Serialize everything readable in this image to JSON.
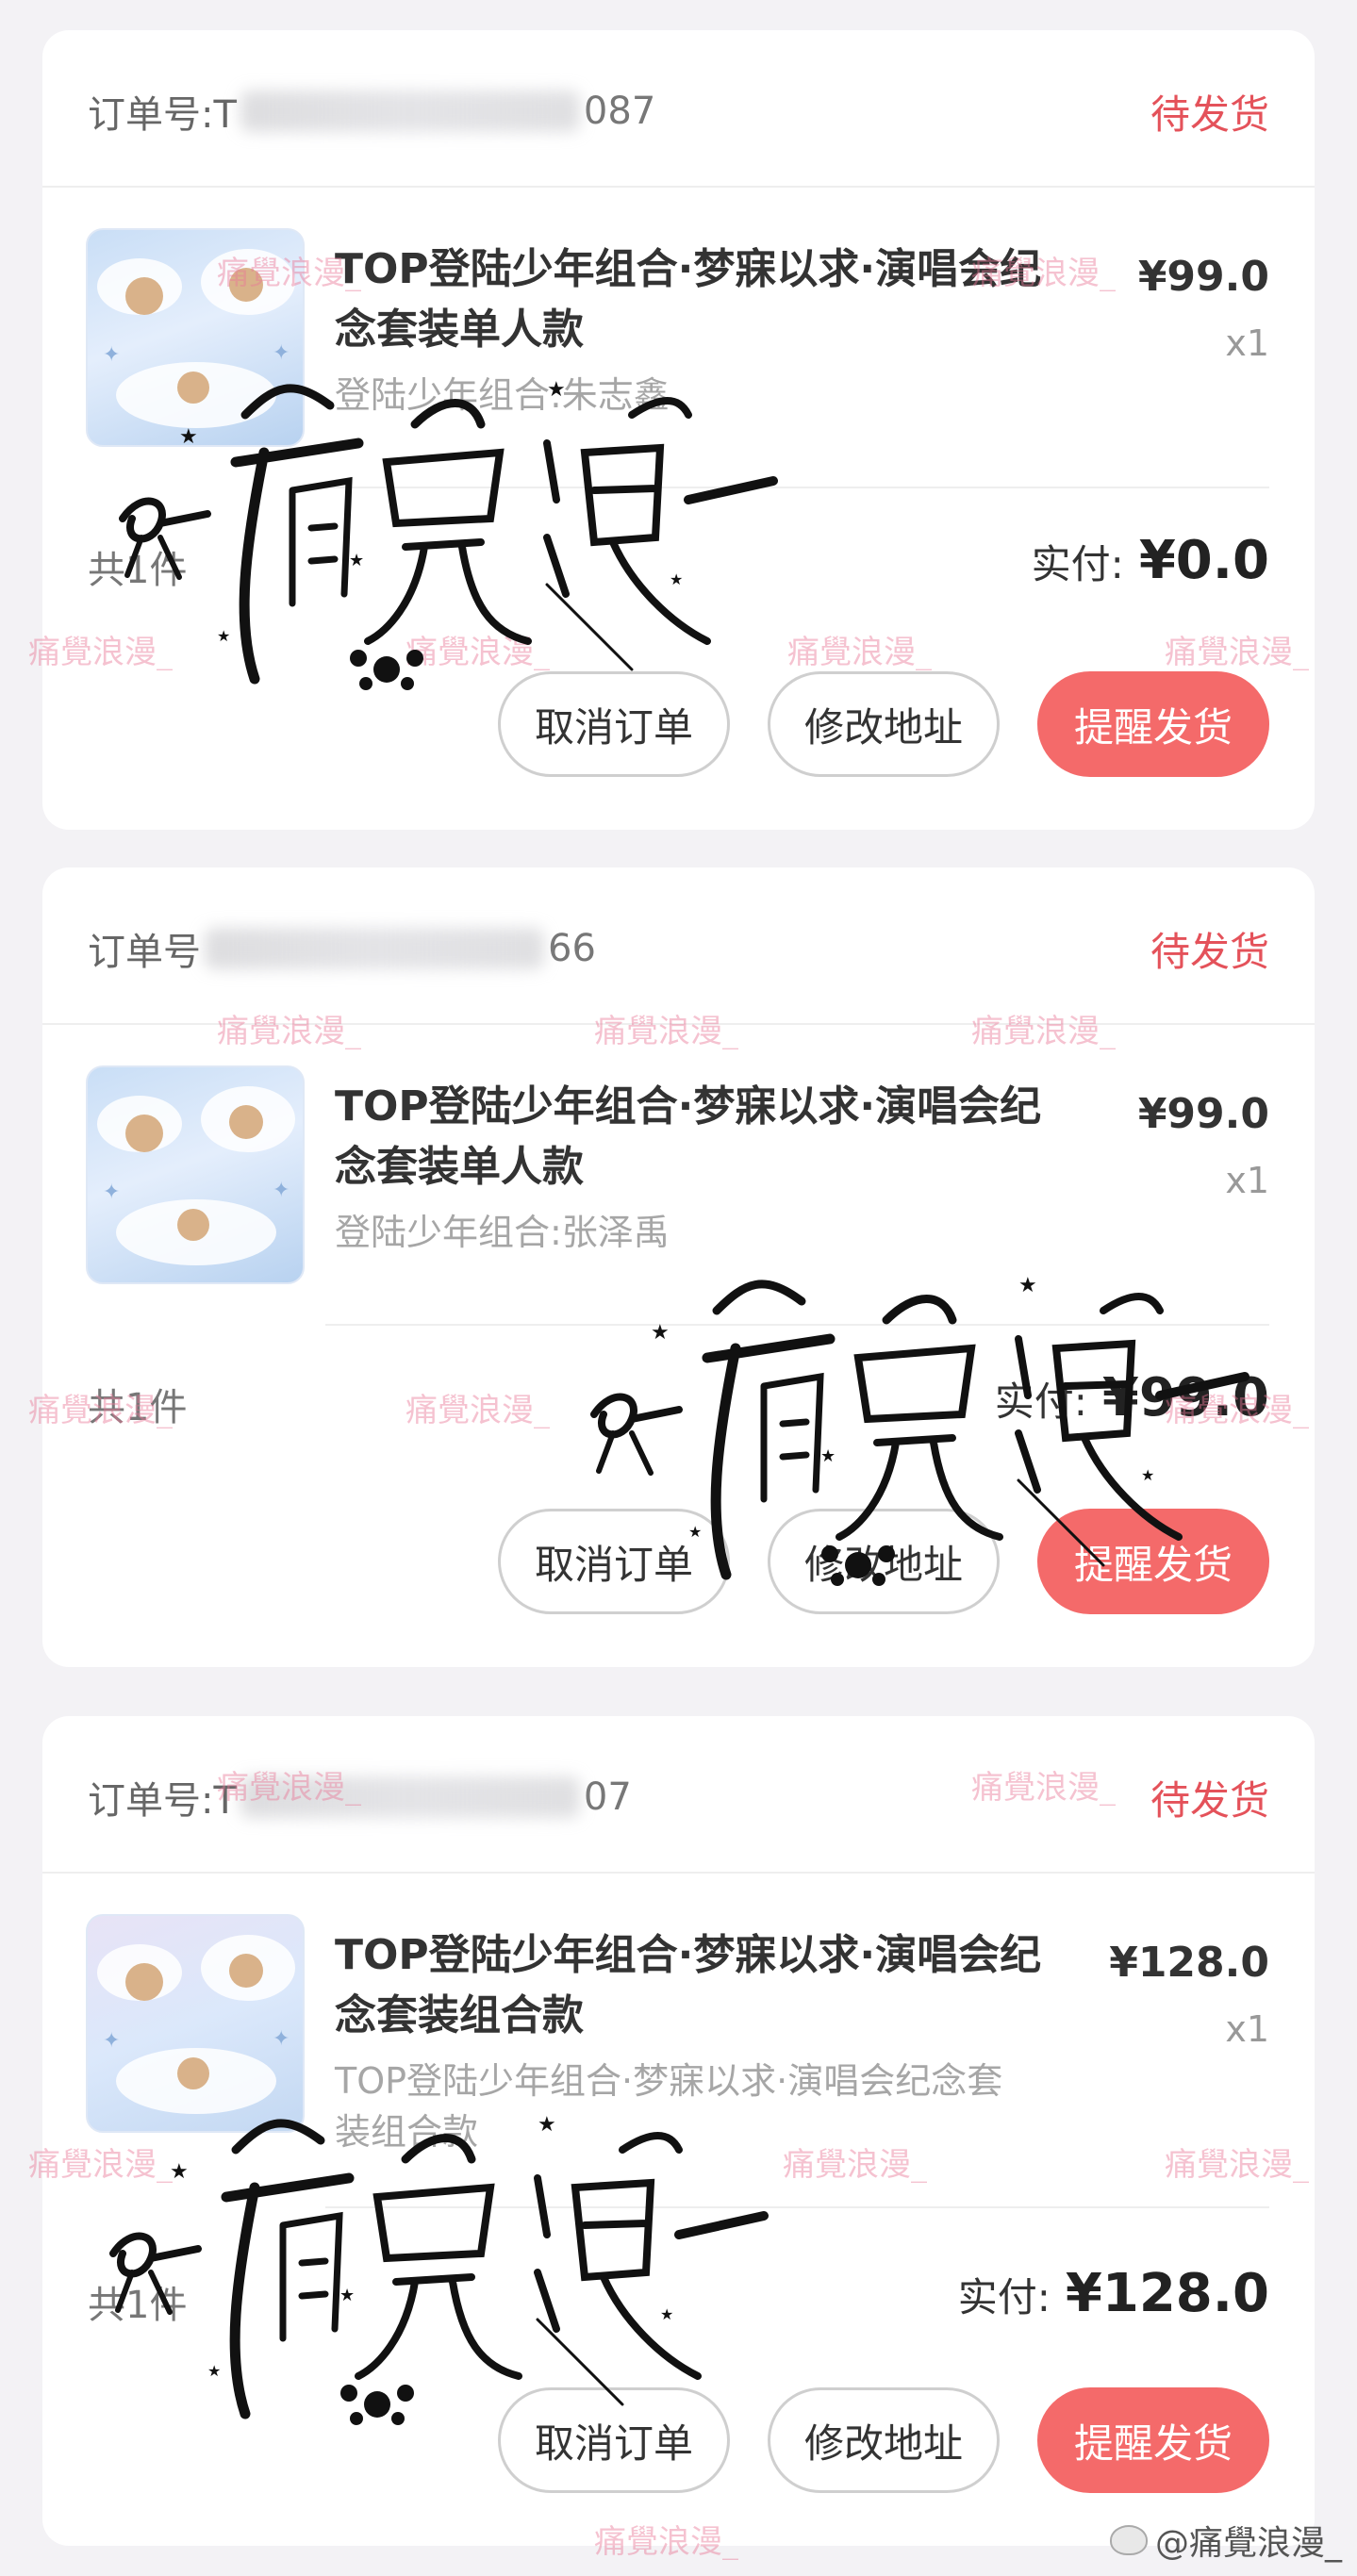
{
  "orders": [
    {
      "order_label": "订单号:T",
      "order_suffix": "087",
      "status": "待发货",
      "title": "TOP登陆少年组合·梦寐以求·演唱会纪念套装单人款",
      "subtitle": "登陆少年组合:朱志鑫",
      "price": "¥99.0",
      "qty": "x1",
      "count": "共1件",
      "paid_label": "实付:",
      "paid_amount": "¥0.0",
      "buttons": [
        "取消订单",
        "修改地址",
        "提醒发货"
      ]
    },
    {
      "order_label": "订单号",
      "order_suffix": "66",
      "status": "待发货",
      "title": "TOP登陆少年组合·梦寐以求·演唱会纪念套装单人款",
      "subtitle": "登陆少年组合:张泽禹",
      "price": "¥99.0",
      "qty": "x1",
      "count": "共1件",
      "paid_label": "实付:",
      "paid_amount": "¥99.0",
      "buttons": [
        "取消订单",
        "修改地址",
        "提醒发货"
      ]
    },
    {
      "order_label": "订单号:T",
      "order_suffix": "07",
      "status": "待发货",
      "title": "TOP登陆少年组合·梦寐以求·演唱会纪念套装组合款",
      "subtitle": "TOP登陆少年组合·梦寐以求·演唱会纪念套装组合款",
      "price": "¥128.0",
      "qty": "x1",
      "count": "共1件",
      "paid_label": "实付:",
      "paid_amount": "¥128.0",
      "buttons": [
        "取消订单",
        "修改地址",
        "提醒发货"
      ]
    }
  ],
  "watermark_text": "痛覺浪漫_",
  "credit": "@痛覺浪漫_",
  "colors": {
    "accent": "#f46a6a",
    "status": "#e4525a",
    "background": "#f3f2f5"
  }
}
